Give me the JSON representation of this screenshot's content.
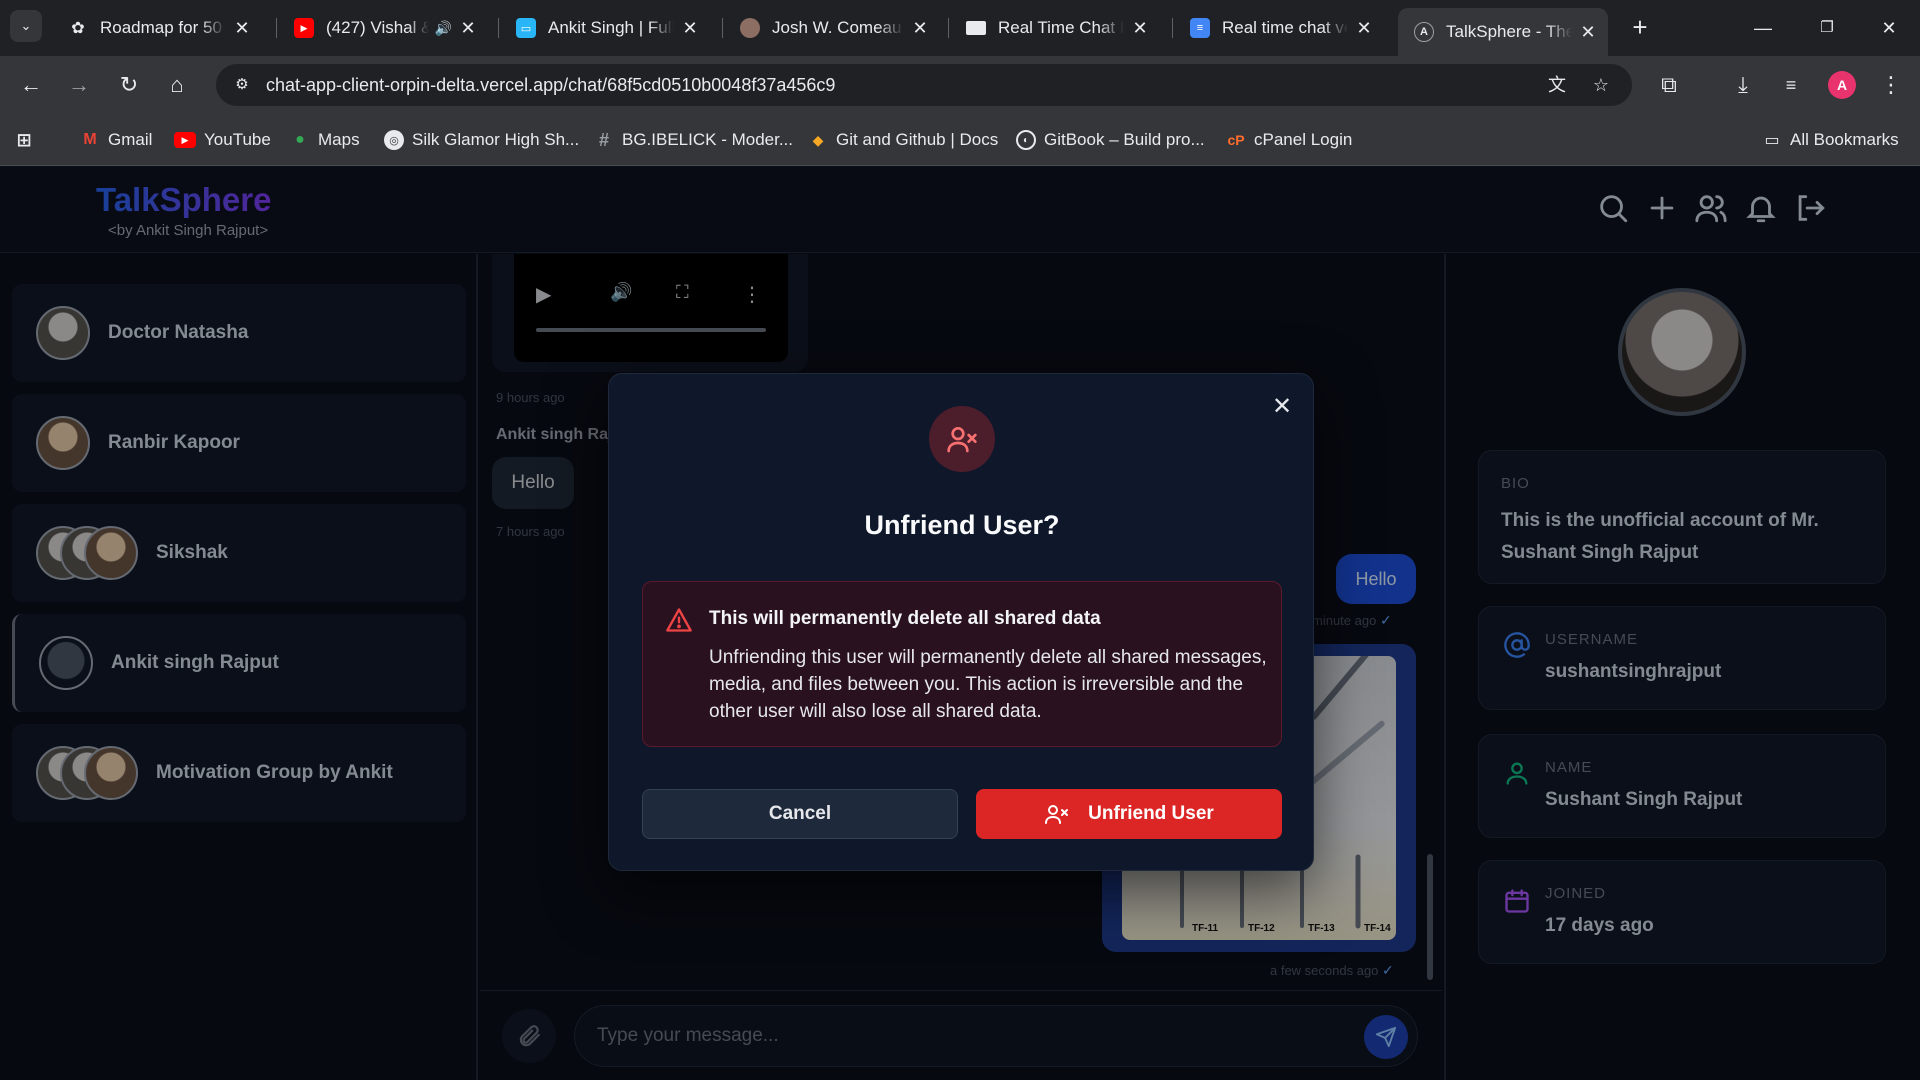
{
  "browser": {
    "tabs": [
      {
        "title": "Roadmap for 50 |",
        "icon": "openai-icon"
      },
      {
        "title": "(427) Vishal &",
        "icon": "youtube-icon"
      },
      {
        "title": "Ankit Singh | Full",
        "icon": "briefcase-icon"
      },
      {
        "title": "Josh W. Comeau",
        "icon": "avatar-icon"
      },
      {
        "title": "Real Time Chat P",
        "icon": "code-icon"
      },
      {
        "title": "Real time chat ve",
        "icon": "docs-icon"
      },
      {
        "title": "TalkSphere - The",
        "icon": "app-icon"
      }
    ],
    "url": "chat-app-client-orpin-delta.vercel.app/chat/68f5cd0510b0048f37a456c9",
    "profile_initial": "A",
    "bookmarks": [
      {
        "label": "Gmail",
        "icon": "gmail-icon"
      },
      {
        "label": "YouTube",
        "icon": "youtube-icon"
      },
      {
        "label": "Maps",
        "icon": "maps-icon"
      },
      {
        "label": "Silk Glamor High Sh...",
        "icon": "globe-icon"
      },
      {
        "label": "BG.IBELICK - Moder...",
        "icon": "hash-icon"
      },
      {
        "label": "Git and Github | Docs",
        "icon": "doc-icon"
      },
      {
        "label": "GitBook – Build pro...",
        "icon": "gitbook-icon"
      },
      {
        "label": "cPanel Login",
        "icon": "cpanel-icon"
      }
    ],
    "all_bookmarks": "All Bookmarks"
  },
  "app": {
    "logo": "TalkSphere",
    "logo_sub": "<by Ankit Singh Rajput>",
    "chats": [
      {
        "name": "Doctor Natasha"
      },
      {
        "name": "Ranbir Kapoor"
      },
      {
        "name": "Sikshak"
      },
      {
        "name": "Ankit singh Rajput"
      },
      {
        "name": "Motivation Group by Ankit"
      }
    ],
    "messages": {
      "video_time": "9 hours ago",
      "sender": "Ankit singh Raj",
      "hello_in": "Hello",
      "hello_in_time": "7 hours ago",
      "hello_out": "Hello",
      "hello_out_time": "minute ago",
      "image_time": "a few seconds ago",
      "image_labels": [
        "TF-11",
        "TF-12",
        "TF-13",
        "TF-14"
      ]
    },
    "composer": {
      "placeholder": "Type your message..."
    },
    "profile": {
      "bio_label": "BIO",
      "bio": "This is the unofficial account of Mr. Sushant Singh Rajput",
      "username_label": "USERNAME",
      "username": "sushantsinghrajput",
      "name_label": "NAME",
      "name": "Sushant Singh Rajput",
      "joined_label": "JOINED",
      "joined": "17 days ago"
    }
  },
  "modal": {
    "title": "Unfriend User?",
    "warning_title": "This will permanently delete all shared data",
    "warning_body": "Unfriending this user will permanently delete all shared messages, media, and files between you. This action is irreversible and the other user will also lose all shared data.",
    "cancel": "Cancel",
    "confirm": "Unfriend User"
  },
  "colors": {
    "danger": "#dc2626",
    "accent": "#1d4ed8",
    "bg": "#0b0f19"
  }
}
